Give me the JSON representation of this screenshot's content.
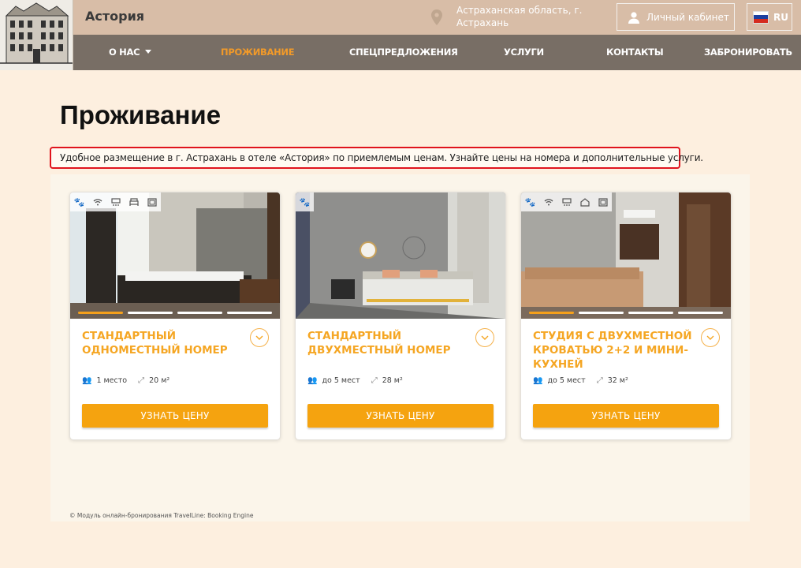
{
  "header": {
    "brand": "Астория",
    "location": "Астраханская область, г. Астрахань",
    "cabinet_label": "Личный кабинет",
    "lang_label": "RU"
  },
  "nav": [
    {
      "label": "О НАС",
      "has_dropdown": true,
      "active": false
    },
    {
      "label": "ПРОЖИВАНИЕ",
      "active": true
    },
    {
      "label": "СПЕЦПРЕДЛОЖЕНИЯ",
      "active": false
    },
    {
      "label": "УСЛУГИ",
      "active": false
    },
    {
      "label": "КОНТАКТЫ",
      "active": false
    },
    {
      "label": "ЗАБРОНИРОВАТЬ",
      "active": false
    }
  ],
  "page": {
    "title": "Проживание",
    "intro": "Удобное размещение в г. Астрахань в отеле «Астория» по приемлемым ценам. Узнайте цены на номера и дополнительные услуги."
  },
  "rooms": [
    {
      "title": "Стандартный одноместный номер",
      "guests": "1 место",
      "area": "20 м²",
      "button": "УЗНАТЬ ЦЕНУ",
      "amenities": [
        "paw-icon",
        "wifi-icon",
        "ac-icon",
        "bed-icon",
        "safe-icon"
      ]
    },
    {
      "title": "Стандартный двухместный номер",
      "guests": "до 5 мест",
      "area": "28 м²",
      "button": "УЗНАТЬ ЦЕНУ",
      "amenities": [
        "paw-icon"
      ]
    },
    {
      "title": "Студия с двухместной кроватью 2+2 и мини-кухней",
      "guests": "до 5 мест",
      "area": "32 м²",
      "button": "УЗНАТЬ ЦЕНУ",
      "amenities": [
        "paw-icon",
        "wifi-icon",
        "ac-icon",
        "kitchen-icon",
        "safe-icon"
      ]
    }
  ],
  "footer_note": "© Модуль онлайн-бронирования TravelLine: Booking Engine",
  "colors": {
    "accent": "#f5a30f",
    "nav_bg": "#786e65",
    "top_bg": "#d8bda7",
    "highlight": "#e0141d"
  }
}
